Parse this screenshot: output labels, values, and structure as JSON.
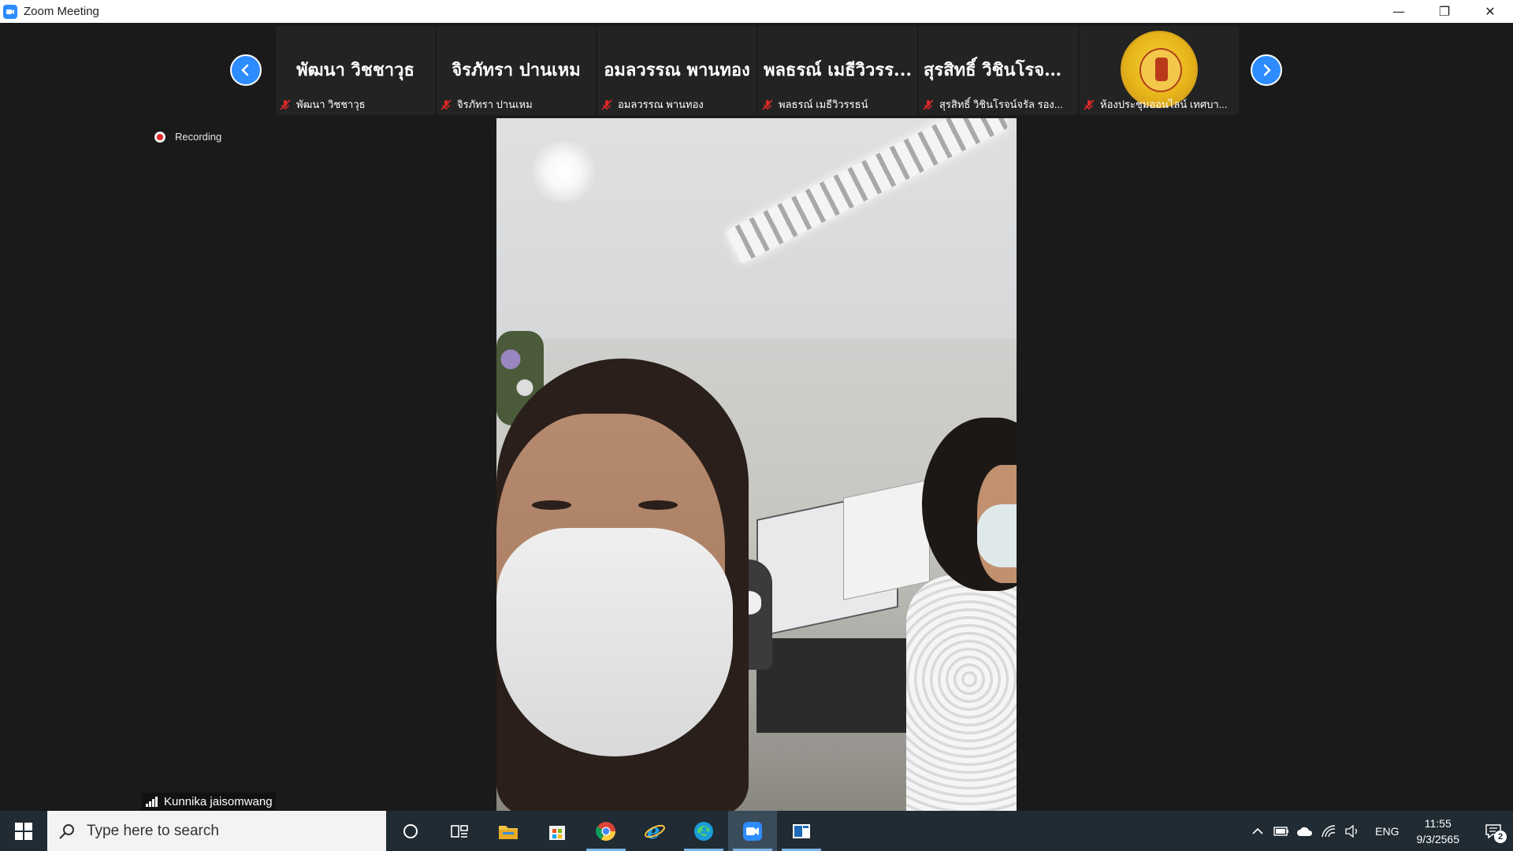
{
  "window": {
    "title": "Zoom Meeting",
    "controls": {
      "minimize": "—",
      "restore": "❐",
      "close": "✕"
    }
  },
  "gallery": {
    "participants": [
      {
        "display_name": "พัฒนา วิชชาวุธ",
        "label": "พัฒนา วิชชาวุธ",
        "muted": true
      },
      {
        "display_name": "จิรภัทรา ปานเหม",
        "label": "จิรภัทรา ปานเหม",
        "muted": true
      },
      {
        "display_name": "อมลวรรณ พานทอง",
        "label": "อมลวรรณ พานทอง",
        "muted": true
      },
      {
        "display_name": "พลธรณ์ เมธีวิวรร...",
        "label": "พลธรณ์ เมธีวิวรรธน์",
        "muted": true
      },
      {
        "display_name": "สุรสิทธิ์ วิชินโรจน์...",
        "label": "สุรสิทธิ์ วิชินโรจน์จรัล รอง...",
        "muted": true
      },
      {
        "display_name": "",
        "label": "ห้องประชุมออนไลน์ เทศบา...",
        "muted": true,
        "avatar": "municipal-seal"
      }
    ]
  },
  "recording": {
    "label": "Recording"
  },
  "main_video": {
    "participant_name": "Kunnika jaisomwang"
  },
  "taskbar": {
    "search_placeholder": "Type here to search",
    "apps": [
      "cortana-icon",
      "task-view-icon",
      "file-explorer-icon",
      "store-icon",
      "chrome-icon",
      "ie-icon",
      "edge-icon",
      "zoom-icon",
      "window-app-icon"
    ],
    "tray": {
      "language": "ENG",
      "time": "11:55",
      "date": "9/3/2565",
      "notifications": "2"
    }
  },
  "colors": {
    "zoom_blue": "#2d8cff",
    "meeting_bg": "#1a1a1a",
    "taskbar_bg": "#202b33",
    "muted_red": "#e02828"
  }
}
